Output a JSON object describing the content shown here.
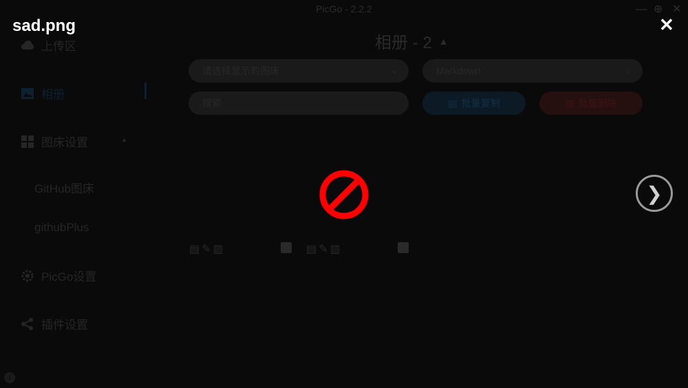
{
  "window": {
    "title": "PicGo - 2.2.2",
    "controls": {
      "minimize": "—",
      "maximize": "⊕",
      "close": "✕"
    }
  },
  "sidebar": {
    "items": [
      {
        "label": "上传区",
        "icon": "upload-cloud-icon"
      },
      {
        "label": "相册",
        "icon": "image-icon",
        "active": true
      },
      {
        "label": "图床设置",
        "icon": "grid-icon"
      },
      {
        "label": "GitHub图床"
      },
      {
        "label": "githubPlus"
      },
      {
        "label": "PicGo设置",
        "icon": "gear-icon"
      },
      {
        "label": "插件设置",
        "icon": "share-icon"
      }
    ]
  },
  "gallery": {
    "title": "相册 - 2",
    "filter_select_placeholder": "请选择显示的图床",
    "format_select_value": "Markdown",
    "search_placeholder": "搜索",
    "batch_copy_label": "批量复制",
    "batch_delete_label": "批量删除"
  },
  "overlay": {
    "filename": "sad.png",
    "close_glyph": "✕",
    "next_glyph": "❯"
  },
  "colors": {
    "overlay_bg": "#0a0a0a",
    "broken_icon": "#ff0000",
    "text_white": "#ffffff"
  }
}
